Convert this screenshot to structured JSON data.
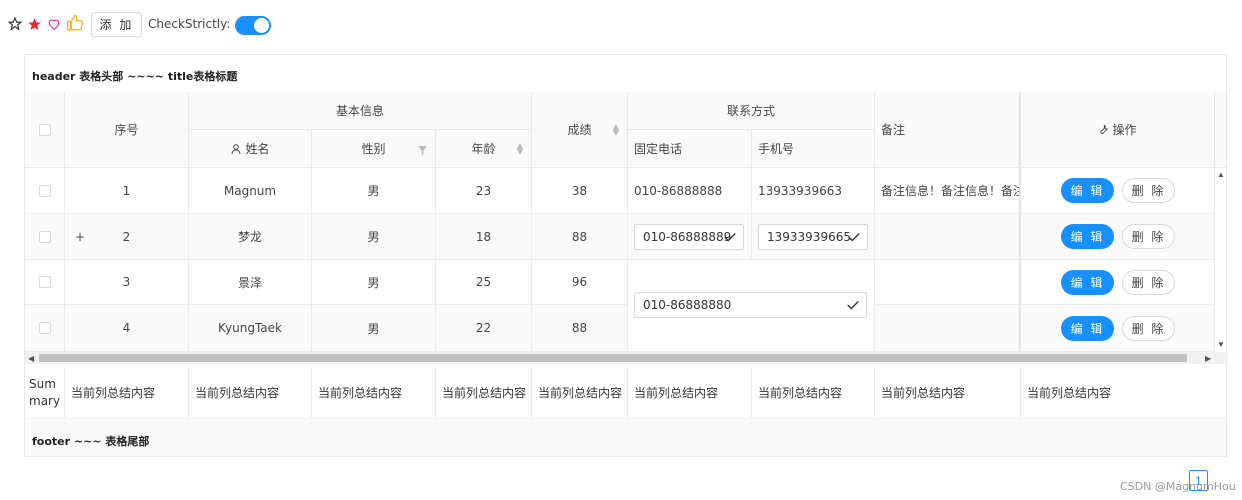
{
  "toolbar": {
    "icons": [
      "star-outline-icon",
      "star-filled-icon",
      "heart-outline-icon",
      "thumbs-up-icon"
    ],
    "add_label": "添 加",
    "check_strictly_label": "CheckStrictly:",
    "check_strictly_on": true,
    "accent": "#1890ff"
  },
  "table": {
    "title": "header 表格头部 ~~~~ title表格标题",
    "headers": {
      "index": "序号",
      "basic_info": "基本信息",
      "name": "姓名",
      "gender": "性别",
      "age": "年龄",
      "score": "成绩",
      "contact": "联系方式",
      "phone": "固定电话",
      "mobile": "手机号",
      "remark": "备注",
      "action": "操作"
    },
    "rows": [
      {
        "index": "1",
        "expand": "",
        "name": "Magnum",
        "gender": "男",
        "age": "23",
        "score": "38",
        "phone": "010-86888888",
        "mobile": "13933939663",
        "remark": "备注信息！备注信息！备注..."
      },
      {
        "index": "2",
        "expand": "+",
        "name": "梦龙",
        "gender": "男",
        "age": "18",
        "score": "88",
        "phone": "010-86888889",
        "mobile": "13933939665",
        "remark": ""
      },
      {
        "index": "3",
        "expand": "",
        "name": "景泽",
        "gender": "男",
        "age": "25",
        "score": "96",
        "phone": "",
        "mobile": "",
        "remark": ""
      },
      {
        "index": "4",
        "expand": "",
        "name": "KyungTaek",
        "gender": "男",
        "age": "22",
        "score": "88",
        "phone": "",
        "mobile": "",
        "remark": ""
      }
    ],
    "merged_phone_value": "010-86888880",
    "edit_label": "编 辑",
    "delete_label": "删 除",
    "summary_label": "Summary",
    "summary_text": "当前列总结内容",
    "footer": "footer ~~~ 表格尾部"
  },
  "pagination": {
    "current": "1"
  },
  "watermark": "CSDN @MagnumHou"
}
